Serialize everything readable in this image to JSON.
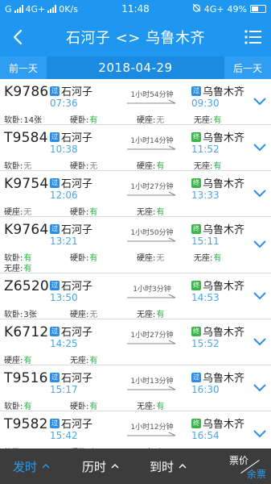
{
  "status_bar": {
    "left_text": "G",
    "net1": "4G+",
    "speed": "0K/s",
    "time": "11:48",
    "net2": "4G+",
    "battery": "49%"
  },
  "header": {
    "title": "石河子 <> 乌鲁木齐",
    "back_icon": "back-arrow-icon",
    "menu_icon": "menu-icon"
  },
  "date_bar": {
    "prev_label": "前一天",
    "date": "2018-04-29",
    "next_label": "后一天"
  },
  "trains": [
    {
      "number": "K9786",
      "from_tag": "过",
      "from": "石河子",
      "dep_time": "07:36",
      "duration": "1小时54分钟",
      "to_tag": "过",
      "to": "乌鲁木齐",
      "arr_time": "09:30",
      "seats": [
        [
          {
            "label": "软卧:",
            "value": "14张",
            "kind": "num"
          },
          {
            "label": "硬卧:",
            "value": "有",
            "kind": "has"
          },
          {
            "label": "硬座:",
            "value": "无",
            "kind": "none"
          },
          {
            "label": "无座:",
            "value": "有",
            "kind": "has"
          }
        ]
      ]
    },
    {
      "number": "T9584",
      "from_tag": "过",
      "from": "石河子",
      "dep_time": "10:38",
      "duration": "1小时14分钟",
      "to_tag": "终",
      "to": "乌鲁木齐",
      "arr_time": "11:52",
      "seats": [
        [
          {
            "label": "软卧:",
            "value": "无",
            "kind": "none"
          },
          {
            "label": "硬卧:",
            "value": "无",
            "kind": "none"
          },
          {
            "label": "硬座:",
            "value": "有",
            "kind": "has"
          },
          {
            "label": "无座:",
            "value": "有",
            "kind": "has"
          }
        ]
      ]
    },
    {
      "number": "K9754",
      "from_tag": "过",
      "from": "石河子",
      "dep_time": "12:06",
      "duration": "1小时27分钟",
      "to_tag": "终",
      "to": "乌鲁木齐",
      "arr_time": "13:33",
      "seats": [
        [
          {
            "label": "硬座:",
            "value": "无",
            "kind": "none"
          },
          {
            "label": "硬卧:",
            "value": "有",
            "kind": "has"
          },
          {
            "label": "无座:",
            "value": "有",
            "kind": "has"
          }
        ]
      ]
    },
    {
      "number": "K9764",
      "from_tag": "过",
      "from": "石河子",
      "dep_time": "13:21",
      "duration": "1小时50分钟",
      "to_tag": "终",
      "to": "乌鲁木齐",
      "arr_time": "15:11",
      "seats": [
        [
          {
            "label": "软卧:",
            "value": "有",
            "kind": "has"
          },
          {
            "label": "硬卧:",
            "value": "有",
            "kind": "has"
          },
          {
            "label": "硬座:",
            "value": "无",
            "kind": "none"
          },
          {
            "label": "无座:",
            "value": "有",
            "kind": "has"
          }
        ],
        [
          {
            "label": "无座:",
            "value": "有",
            "kind": "has"
          }
        ]
      ]
    },
    {
      "number": "Z6520",
      "from_tag": "过",
      "from": "石河子",
      "dep_time": "13:50",
      "duration": "1小时3分钟",
      "to_tag": "终",
      "to": "乌鲁木齐",
      "arr_time": "14:53",
      "seats": [
        [
          {
            "label": "软卧:",
            "value": "3张",
            "kind": "num"
          },
          {
            "label": "硬座:",
            "value": "无",
            "kind": "none"
          },
          {
            "label": "无座:",
            "value": "有",
            "kind": "has"
          }
        ]
      ]
    },
    {
      "number": "K6712",
      "from_tag": "过",
      "from": "石河子",
      "dep_time": "14:25",
      "duration": "1小时27分钟",
      "to_tag": "终",
      "to": "乌鲁木齐",
      "arr_time": "15:52",
      "seats": [
        [
          {
            "label": "硬座:",
            "value": "有",
            "kind": "has"
          },
          {
            "label": "无座:",
            "value": "有",
            "kind": "has"
          }
        ]
      ]
    },
    {
      "number": "T9516",
      "from_tag": "过",
      "from": "石河子",
      "dep_time": "15:17",
      "duration": "1小时13分钟",
      "to_tag": "过",
      "to": "乌鲁木齐",
      "arr_time": "16:30",
      "seats": [
        [
          {
            "label": "软卧:",
            "value": "有",
            "kind": "has"
          },
          {
            "label": "硬卧:",
            "value": "有",
            "kind": "has"
          },
          {
            "label": "无座:",
            "value": "有",
            "kind": "has"
          }
        ]
      ]
    },
    {
      "number": "T9582",
      "from_tag": "过",
      "from": "石河子",
      "dep_time": "15:42",
      "duration": "1小时12分钟",
      "to_tag": "终",
      "to": "乌鲁木齐",
      "arr_time": "16:54",
      "seats": [
        [
          {
            "label": "软卧:",
            "value": "无",
            "kind": "none"
          },
          {
            "label": "硬卧:",
            "value": "有",
            "kind": "has"
          },
          {
            "label": "无座:",
            "value": "有",
            "kind": "has"
          }
        ]
      ]
    }
  ],
  "bottom_bar": {
    "departure_label": "发时",
    "duration_label": "历时",
    "arrival_label": "到时",
    "price_label": "票价",
    "remaining_label": "余票"
  },
  "colors": {
    "primary": "#1f97f0",
    "accent_text": "#4aa7e6",
    "available": "#2bb043",
    "bottom_bg": "#3c3c3c"
  }
}
